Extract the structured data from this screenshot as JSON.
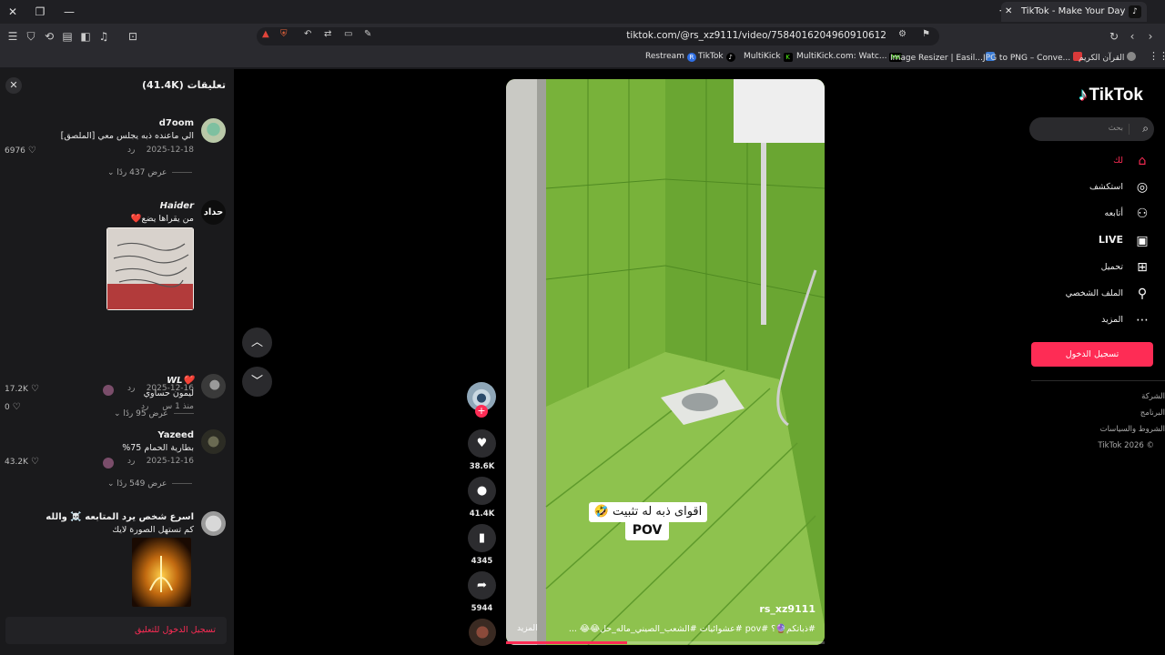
{
  "browser": {
    "tab_title": "TikTok - Make Your Day",
    "url": "tiktok.com/@rs_xz9111/video/7584016204960910612",
    "bookmarks": [
      "Restream",
      "TikTok",
      "MultiKick",
      "MultiKick.com: Watc...",
      "Image Resizer | Easil...",
      "JPG to PNG – Conve...",
      "القرآن الكريم"
    ]
  },
  "comments": {
    "title": "تعليقات (41.4K)",
    "reply_label": "رد",
    "items": [
      {
        "user": "d7oom",
        "text": "الي ماعنده ذبه يجلس معي [الملصق]",
        "date": "2025-12-18",
        "likes": "6976",
        "view_replies": "عرض 437 ردًا"
      },
      {
        "user": "Haider",
        "text": "من يقراها يضع❤️",
        "date": "2025-12-16",
        "likes": "17.2K",
        "view_replies": "عرض 95 ردًا"
      },
      {
        "user": "❤️WL",
        "text": "ليمون حساوي",
        "date": "منذ 1 س",
        "likes": "0"
      },
      {
        "user": "Yazeed",
        "text": "بطارية الحمام 75%",
        "date": "2025-12-16",
        "likes": "43.2K",
        "view_replies": "عرض 549 ردًا"
      },
      {
        "user": "اسرع شخص يرد المتابعه ☠️ والله",
        "text": "كم تستهل الصورة لايك"
      }
    ],
    "avatar_text_haider": "حداد",
    "login_prompt": "تسجيل الدخول للتعليق"
  },
  "video": {
    "overlay_line1": "اقواى ذبه له تثبيت 🤣",
    "overlay_line2": "POV",
    "author": "rs_xz9111",
    "description": "#ذباتكم🔮؟ #pov #عشوائيات #الشعب_الصيني_ماله_حل😂😂 ...",
    "more_label": "المزيد",
    "progress": 0.38,
    "likes": "38.6K",
    "comments": "41.4K",
    "saves": "4345",
    "shares": "5944"
  },
  "sidebar": {
    "logo": "TikTok",
    "search_placeholder": "بحث",
    "nav": [
      {
        "label": "لك",
        "icon": "home-icon",
        "active": true
      },
      {
        "label": "استكشف",
        "icon": "compass-icon"
      },
      {
        "label": "أتابعه",
        "icon": "user-plus-icon"
      },
      {
        "label": "LIVE",
        "icon": "live-icon"
      },
      {
        "label": "تحميل",
        "icon": "upload-icon"
      },
      {
        "label": "الملف الشخصي",
        "icon": "profile-icon"
      },
      {
        "label": "المزيد",
        "icon": "more-icon"
      }
    ],
    "login_button": "تسجيل الدخول",
    "footer": [
      "الشركة",
      "البرنامج",
      "الشروط والسياسات",
      "© 2026 TikTok"
    ]
  },
  "colors": {
    "accent": "#fe2c55",
    "panel": "#1a1a1c",
    "tile_green": "#7cae3a"
  }
}
